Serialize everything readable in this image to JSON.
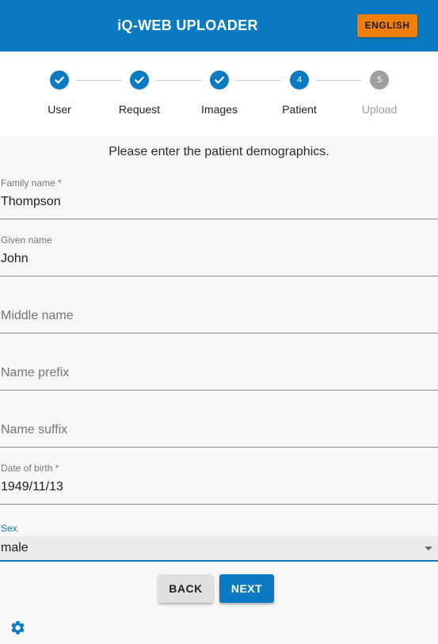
{
  "header": {
    "title": "iQ-WEB UPLOADER",
    "language_button": "ENGLISH",
    "brand_color": "#0a7bc2",
    "accent_color": "#f07f0a"
  },
  "stepper": {
    "steps": [
      {
        "label": "User",
        "status": "complete",
        "icon": "check-icon"
      },
      {
        "label": "Request",
        "status": "complete",
        "icon": "check-icon"
      },
      {
        "label": "Images",
        "status": "complete",
        "icon": "check-icon"
      },
      {
        "label": "Patient",
        "status": "active",
        "number": "4"
      },
      {
        "label": "Upload",
        "status": "disabled",
        "number": "5"
      }
    ]
  },
  "form": {
    "instruction": "Please enter the patient demographics.",
    "family_name": {
      "label": "Family name *",
      "value": "Thompson"
    },
    "given_name": {
      "label": "Given name",
      "value": "John"
    },
    "middle_name": {
      "placeholder": "Middle name",
      "value": ""
    },
    "name_prefix": {
      "placeholder": "Name prefix",
      "value": ""
    },
    "name_suffix": {
      "placeholder": "Name suffix",
      "value": ""
    },
    "date_of_birth": {
      "label": "Date of birth *",
      "value": "1949/11/13"
    },
    "sex": {
      "label": "Sex",
      "value": "male"
    }
  },
  "actions": {
    "back": "BACK",
    "next": "NEXT"
  },
  "footer": {
    "settings_icon": "gear-icon"
  }
}
